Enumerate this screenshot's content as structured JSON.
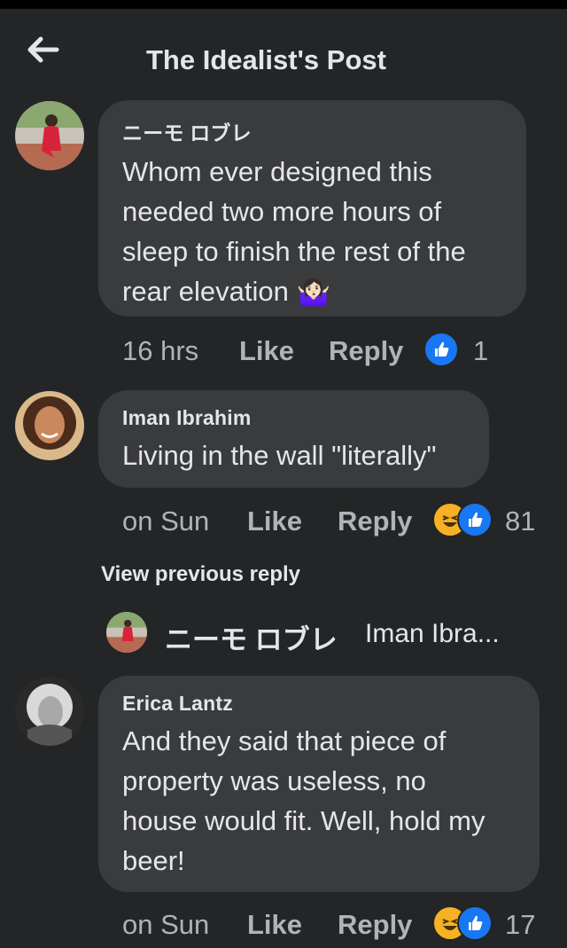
{
  "header": {
    "title": "The Idealist's Post",
    "back_icon": "arrow-left-icon"
  },
  "comments": [
    {
      "author": "ニーモ ロブレ",
      "text_lines": [
        "Whom ever designed this",
        "needed two more hours of",
        "sleep to finish the rest of the",
        "rear elevation 🤷🏻‍♀️"
      ],
      "time": "16 hrs",
      "like": "Like",
      "reply": "Reply",
      "reactions": [
        "like-icon"
      ],
      "count": "1"
    },
    {
      "author": "Iman Ibrahim",
      "text_lines": [
        "Living in the wall \"literally\""
      ],
      "time": "on Sun",
      "like": "Like",
      "reply": "Reply",
      "reactions": [
        "haha-icon",
        "like-icon"
      ],
      "count": "81"
    },
    {
      "author": "Erica Lantz",
      "text_lines": [
        "And they said that piece of",
        "property was useless, no",
        "house would fit. Well, hold my",
        "beer!"
      ],
      "time": "on Sun",
      "like": "Like",
      "reply": "Reply",
      "reactions": [
        "haha-icon",
        "like-icon"
      ],
      "count": "17"
    }
  ],
  "view_previous": "View previous reply",
  "reply_preview": {
    "name": "ニーモ ロブレ",
    "snippet": "Iman Ibra..."
  },
  "colors": {
    "background": "#242526",
    "bubble": "#3a3b3c",
    "text": "#e4e6eb",
    "muted": "#b0b3b8",
    "like_blue": "#1877f2",
    "haha_yellow": "#f7b125"
  }
}
